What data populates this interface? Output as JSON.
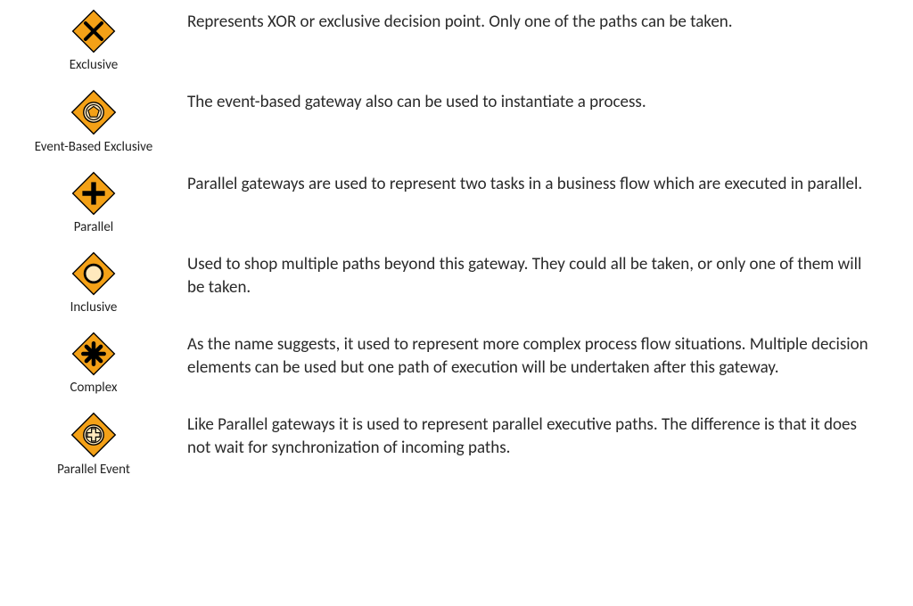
{
  "gateways": [
    {
      "label": "Exclusive",
      "desc": "Represents XOR or exclusive decision point. Only one of the paths can be taken."
    },
    {
      "label": "Event-Based Exclusive",
      "desc": "The event-based gateway also can be used to instantiate a process."
    },
    {
      "label": "Parallel",
      "desc": "Parallel gateways are used to represent two tasks in a business flow which are executed in parallel."
    },
    {
      "label": "Inclusive",
      "desc": "Used to shop multiple paths beyond this gateway. They could all be taken, or only one of them will be taken."
    },
    {
      "label": "Complex",
      "desc": "As the name suggests, it used to represent more complex process flow situations. Multiple decision elements can be used but one path of execution will be undertaken after this gateway."
    },
    {
      "label": "Parallel Event",
      "desc": "Like Parallel gateways it is used to represent parallel executive paths. The difference is that it does not wait for synchronization of incoming paths."
    }
  ],
  "colors": {
    "fill": "#f4a117",
    "stroke": "#000000",
    "innerFill": "#ffe9bd"
  }
}
